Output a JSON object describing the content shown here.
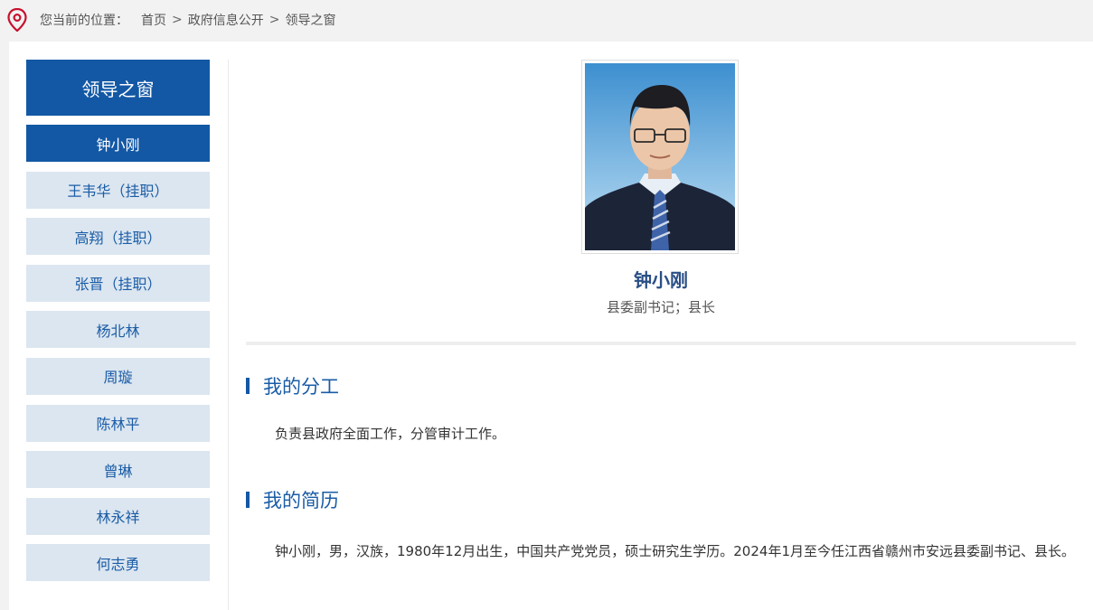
{
  "breadcrumb": {
    "lead": "您当前的位置：",
    "items": [
      "首页",
      "政府信息公开",
      "领导之窗"
    ],
    "separator": ">"
  },
  "sidebar": {
    "heading": "领导之窗",
    "items": [
      {
        "label": "钟小刚",
        "active": true
      },
      {
        "label": "王韦华（挂职）"
      },
      {
        "label": "高翔（挂职）"
      },
      {
        "label": "张晋（挂职）"
      },
      {
        "label": "杨北林"
      },
      {
        "label": "周璇"
      },
      {
        "label": "陈林平"
      },
      {
        "label": "曾琳"
      },
      {
        "label": "林永祥"
      },
      {
        "label": "何志勇"
      }
    ]
  },
  "profile": {
    "name": "钟小刚",
    "title": "县委副书记；县长"
  },
  "sections": {
    "duties": {
      "heading": "我的分工",
      "text": "负责县政府全面工作，分管审计工作。"
    },
    "resume": {
      "heading": "我的简历",
      "text": "钟小刚，男，汉族，1980年12月出生，中国共产党党员，硕士研究生学历。2024年1月至今任江西省赣州市安远县委副书记、县长。"
    }
  },
  "colors": {
    "accent": "#1358a5",
    "sidebar_item_bg": "#dce6f0",
    "sidebar_item_text": "#1a5ca6",
    "name_color": "#2a4f86",
    "pin_icon": "#c8102e"
  },
  "icons": {
    "location": "location-pin-icon"
  }
}
